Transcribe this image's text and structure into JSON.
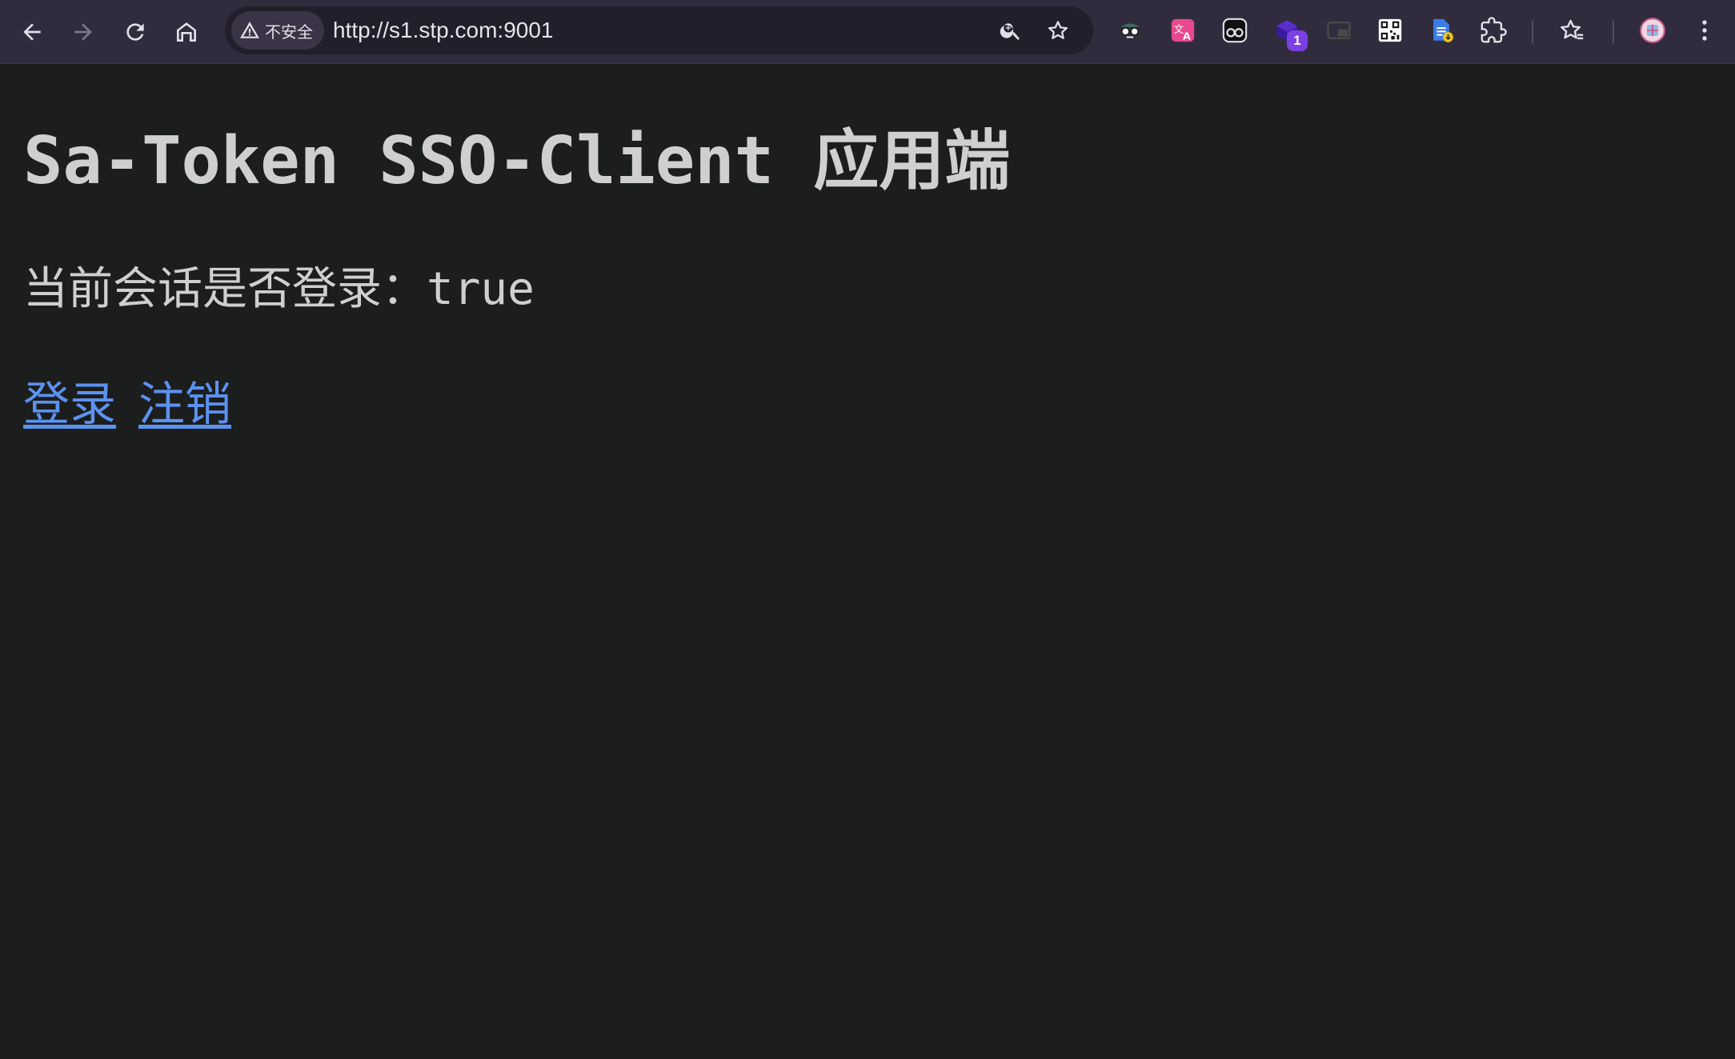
{
  "browser": {
    "security_label": "不安全",
    "url": "http://s1.stp.com:9001",
    "extension_badge": "1"
  },
  "page": {
    "title": "Sa-Token SSO-Client 应用端",
    "status_label": "当前会话是否登录：",
    "status_value": "true",
    "login_link": "登录",
    "logout_link": "注销"
  },
  "colors": {
    "page_background": "#1c1d1d",
    "toolbar_background": "#312c3d",
    "link": "#5b92ef",
    "text": "#cfcfcf"
  }
}
